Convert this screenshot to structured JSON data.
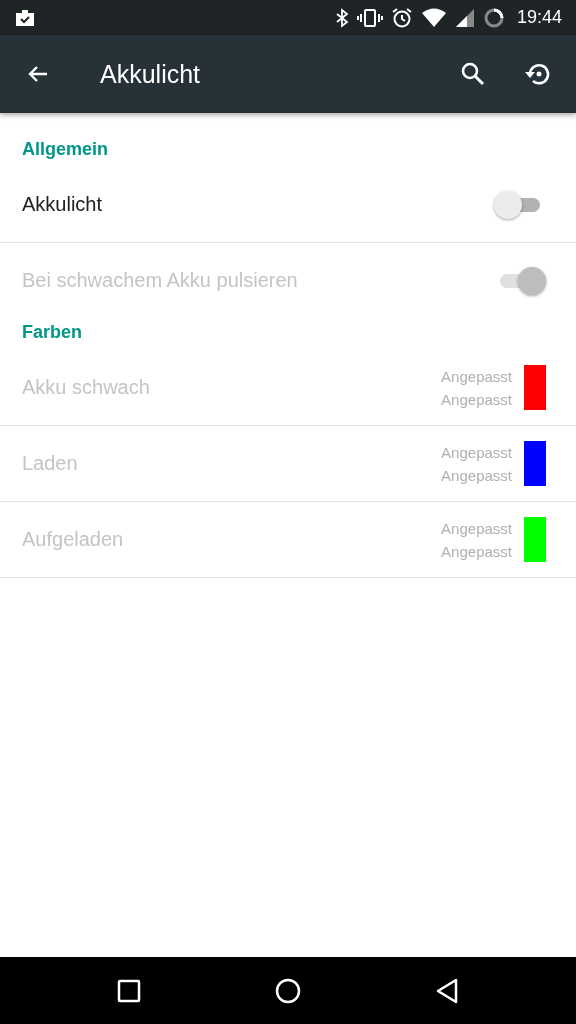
{
  "status_bar": {
    "time": "19:44"
  },
  "toolbar": {
    "title": "Akkulicht"
  },
  "sections": [
    {
      "header": "Allgemein",
      "items": [
        {
          "kind": "switch",
          "label": "Akkulicht",
          "checked": false,
          "disabled": false
        },
        {
          "kind": "switch",
          "label": "Bei schwachem Akku pulsieren",
          "checked": true,
          "disabled": true
        }
      ]
    },
    {
      "header": "Farben",
      "items": [
        {
          "kind": "color",
          "label": "Akku schwach",
          "values": [
            "Angepasst",
            "Angepasst"
          ],
          "color": "#ff0000",
          "disabled": true
        },
        {
          "kind": "color",
          "label": "Laden",
          "values": [
            "Angepasst",
            "Angepasst"
          ],
          "color": "#0000ff",
          "disabled": true
        },
        {
          "kind": "color",
          "label": "Aufgeladen",
          "values": [
            "Angepasst",
            "Angepasst"
          ],
          "color": "#00ff00",
          "disabled": true
        }
      ]
    }
  ]
}
